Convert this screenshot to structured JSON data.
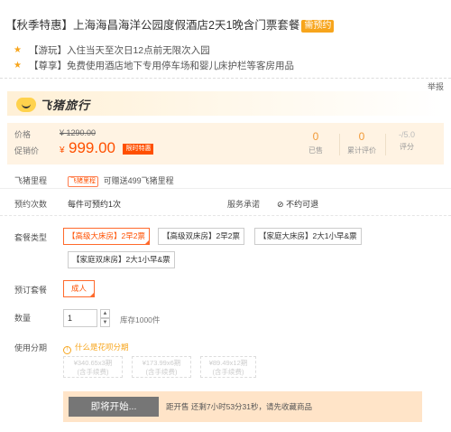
{
  "header": {
    "title": "【秋季特惠】上海海昌海洋公园度假酒店2天1晚含门票套餐",
    "presale_badge": "需预约",
    "perks": [
      {
        "tag": "【游玩】",
        "text": "入住当天至次日12点前无限次入园"
      },
      {
        "tag": "【尊享】",
        "text": "免费使用酒店地下专用停车场和婴儿床护栏等客房用品"
      }
    ],
    "report_link": "举报"
  },
  "brand": {
    "name": "飞猪旅行"
  },
  "price": {
    "original_label": "价格",
    "original_value": "¥ 1290.00",
    "promo_label": "促销价",
    "currency": "¥",
    "promo_value": "999.00",
    "promo_tag": "限时特惠",
    "stats": [
      {
        "value": "0",
        "label": "已售"
      },
      {
        "value": "0",
        "label": "累计评价"
      },
      {
        "value": "-/5.0",
        "label": "评分"
      }
    ]
  },
  "meta": {
    "mileage_label": "飞猪里程",
    "mileage_tag": "飞猪里程",
    "mileage_text": "可赠送499飞猪里程",
    "booking_label": "预约次数",
    "booking_value": "每件可预约1次",
    "service_label": "服务承诺",
    "service_value": "不约可退"
  },
  "options": {
    "room_label": "套餐类型",
    "rooms": [
      "【高级大床房】2早2票",
      "【高级双床房】2早2票",
      "【家庭大床房】2大1小早&票",
      "【家庭双床房】2大1小早&票"
    ],
    "package_label": "预订套餐",
    "packages": [
      "成人"
    ],
    "quantity_label": "数量",
    "quantity": "1",
    "stock_text": "库存1000件",
    "installment_label": "使用分期",
    "installment_help": "什么是花呗分期",
    "installments": [
      {
        "line1": "¥340.65x3期",
        "line2": "(含手续费)"
      },
      {
        "line1": "¥173.99x6期",
        "line2": "(含手续费)"
      },
      {
        "line1": "¥89.49x12期",
        "line2": "(含手续费)"
      }
    ]
  },
  "footer": {
    "start_button": "即将开始...",
    "countdown": "距开售 还剩7小时53分31秒，请先收藏商品"
  },
  "colors": {
    "accent": "#ff5000",
    "badge": "#f7a51c",
    "price_bg": "#fff3e3",
    "footer_bg": "#ffe4c8"
  }
}
